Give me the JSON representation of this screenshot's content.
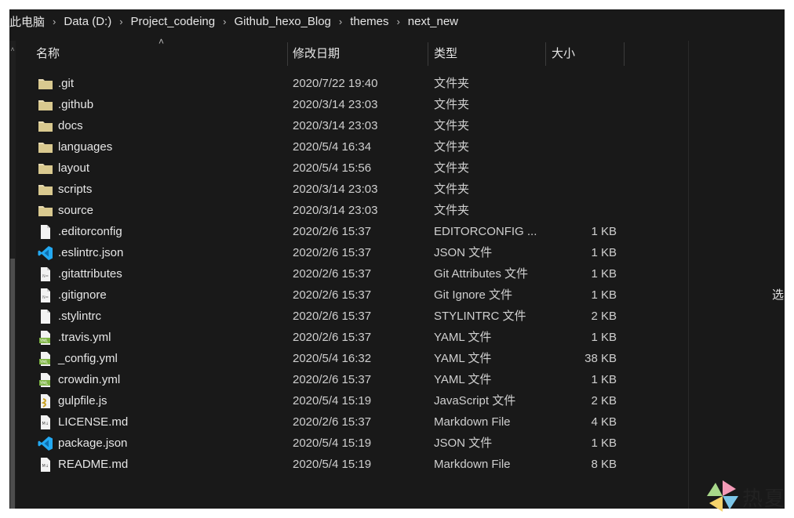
{
  "breadcrumb": [
    "此电脑",
    "Data (D:)",
    "Project_codeing",
    "Github_hexo_Blog",
    "themes",
    "next_new"
  ],
  "columns": {
    "name": "名称",
    "date": "修改日期",
    "type": "类型",
    "size": "大小"
  },
  "preview_pane": {
    "text": "选"
  },
  "files": [
    {
      "name": ".git",
      "date": "2020/7/22 19:40",
      "type": "文件夹",
      "size": "",
      "icon": "folder-icon"
    },
    {
      "name": ".github",
      "date": "2020/3/14 23:03",
      "type": "文件夹",
      "size": "",
      "icon": "folder-icon"
    },
    {
      "name": "docs",
      "date": "2020/3/14 23:03",
      "type": "文件夹",
      "size": "",
      "icon": "folder-icon"
    },
    {
      "name": "languages",
      "date": "2020/5/4 16:34",
      "type": "文件夹",
      "size": "",
      "icon": "folder-icon"
    },
    {
      "name": "layout",
      "date": "2020/5/4 15:56",
      "type": "文件夹",
      "size": "",
      "icon": "folder-icon"
    },
    {
      "name": "scripts",
      "date": "2020/3/14 23:03",
      "type": "文件夹",
      "size": "",
      "icon": "folder-icon"
    },
    {
      "name": "source",
      "date": "2020/3/14 23:03",
      "type": "文件夹",
      "size": "",
      "icon": "folder-icon"
    },
    {
      "name": ".editorconfig",
      "date": "2020/2/6 15:37",
      "type": "EDITORCONFIG ...",
      "size": "1 KB",
      "icon": "blank-file-icon"
    },
    {
      "name": ".eslintrc.json",
      "date": "2020/2/6 15:37",
      "type": "JSON 文件",
      "size": "1 KB",
      "icon": "vscode-file-icon"
    },
    {
      "name": ".gitattributes",
      "date": "2020/2/6 15:37",
      "type": "Git Attributes 文件",
      "size": "1 KB",
      "icon": "text-file-icon"
    },
    {
      "name": ".gitignore",
      "date": "2020/2/6 15:37",
      "type": "Git Ignore 文件",
      "size": "1 KB",
      "icon": "text-file-icon"
    },
    {
      "name": ".stylintrc",
      "date": "2020/2/6 15:37",
      "type": "STYLINTRC 文件",
      "size": "2 KB",
      "icon": "blank-file-icon"
    },
    {
      "name": ".travis.yml",
      "date": "2020/2/6 15:37",
      "type": "YAML 文件",
      "size": "1 KB",
      "icon": "yaml-file-icon"
    },
    {
      "name": "_config.yml",
      "date": "2020/5/4 16:32",
      "type": "YAML 文件",
      "size": "38 KB",
      "icon": "yaml-file-icon"
    },
    {
      "name": "crowdin.yml",
      "date": "2020/2/6 15:37",
      "type": "YAML 文件",
      "size": "1 KB",
      "icon": "yaml-file-icon"
    },
    {
      "name": "gulpfile.js",
      "date": "2020/5/4 15:19",
      "type": "JavaScript 文件",
      "size": "2 KB",
      "icon": "js-file-icon"
    },
    {
      "name": "LICENSE.md",
      "date": "2020/2/6 15:37",
      "type": "Markdown File",
      "size": "4 KB",
      "icon": "markdown-file-icon"
    },
    {
      "name": "package.json",
      "date": "2020/5/4 15:19",
      "type": "JSON 文件",
      "size": "1 KB",
      "icon": "vscode-file-icon"
    },
    {
      "name": "README.md",
      "date": "2020/5/4 15:19",
      "type": "Markdown File",
      "size": "8 KB",
      "icon": "markdown-file-icon"
    }
  ],
  "watermark": {
    "text": "热夏"
  },
  "colors": {
    "background": "#191919",
    "text": "#e6e6e6",
    "folder": "#e8dcb5",
    "vscode_blue": "#23a9f2",
    "yaml_green": "#7cb342"
  }
}
